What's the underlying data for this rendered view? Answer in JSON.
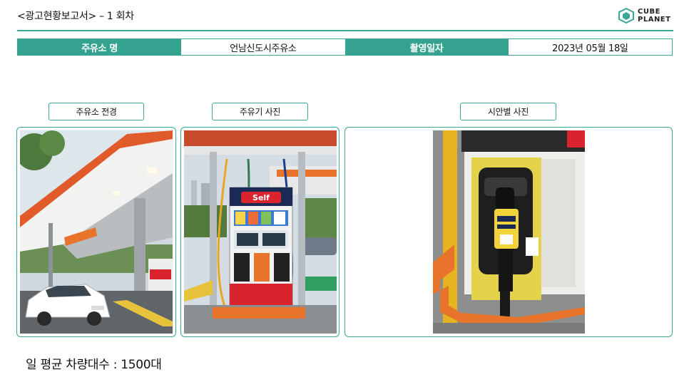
{
  "report": {
    "title": "<광고현황보고서>  – 1 회차"
  },
  "logo": {
    "line1": "CUBE",
    "line2": "PLANET",
    "icon": "cube-logo-icon"
  },
  "info_table": {
    "station_label": "주유소 명",
    "station_value": "언남신도시주유소",
    "date_label": "촬영일자",
    "date_value": "2023년 05월 18일"
  },
  "photos": {
    "station_view": "주유소 전경",
    "pump_photo": "주유기 사진",
    "implementation_photo": "시안별 사진"
  },
  "footer": {
    "daily_traffic": "일 평균 차량대수 : 1500대"
  },
  "colors": {
    "accent": "#35a38f",
    "border": "#3aa896",
    "brand_orange": "#e8742c",
    "brand_red": "#d9232e"
  }
}
